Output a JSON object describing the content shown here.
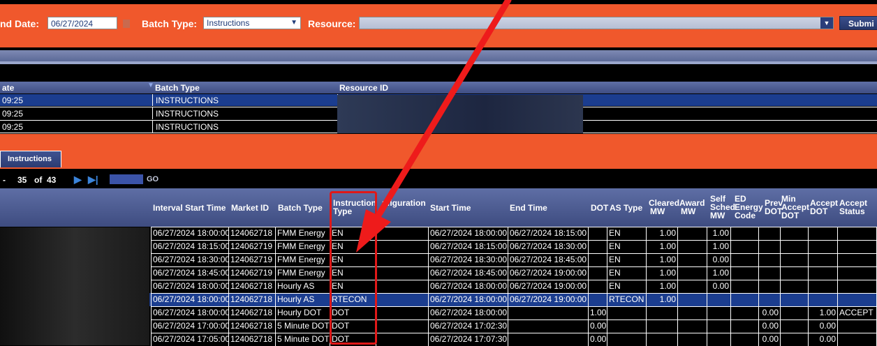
{
  "toolbar": {
    "end_date_label": "nd Date:",
    "end_date_value": "06/27/2024",
    "batch_type_label": "Batch Type:",
    "batch_type_value": "Instructions",
    "resource_label": "Resource:",
    "submit_label": "Submi"
  },
  "batch_table": {
    "headers": [
      "ate",
      "Batch Type",
      "Resource ID"
    ],
    "rows": [
      {
        "time": "09:25",
        "batch_type": "INSTRUCTIONS"
      },
      {
        "time": "09:25",
        "batch_type": "INSTRUCTIONS"
      },
      {
        "time": "09:25",
        "batch_type": "INSTRUCTIONS"
      }
    ]
  },
  "tab": {
    "label": "Instructions"
  },
  "pager": {
    "dash": "-",
    "current": "35",
    "of": "of",
    "total": "43",
    "go": "GO"
  },
  "grid": {
    "headers": {
      "interval_start": "Interval Start Time",
      "market_id": "Market ID",
      "batch_type": "Batch Type",
      "instr1": "Instruction",
      "instr2": "Type",
      "config": "nfiguration",
      "start_time": "Start Time",
      "end_time": "End Time",
      "dot": "DOT",
      "as_type": "AS Type",
      "cleared1": "Cleared",
      "cleared2": "MW",
      "award1": "Award",
      "award2": "MW",
      "self1": "Self",
      "self2": "Sched",
      "self3": "MW",
      "ed1": "ED",
      "ed2": "Energy",
      "ed3": "Code",
      "prev1": "Prev",
      "prev2": "DOT",
      "min1": "Min",
      "min2": "Accept",
      "min3": "DOT",
      "accept1": "Accept",
      "accept2": "DOT",
      "astatus1": "Accept",
      "astatus2": "Status"
    },
    "rows": [
      {
        "interval": "06/27/2024 18:00:00",
        "market": "124062718",
        "batch": "FMM Energy",
        "itype": "EN",
        "start": "06/27/2024 18:00:00",
        "end": "06/27/2024 18:15:00",
        "dot": "",
        "as": "EN",
        "cleared": "1.00",
        "award": "",
        "self": "1.00",
        "prev": "",
        "accept": "",
        "status": ""
      },
      {
        "interval": "06/27/2024 18:15:00",
        "market": "124062719",
        "batch": "FMM Energy",
        "itype": "EN",
        "start": "06/27/2024 18:15:00",
        "end": "06/27/2024 18:30:00",
        "dot": "",
        "as": "EN",
        "cleared": "1.00",
        "award": "",
        "self": "1.00",
        "prev": "",
        "accept": "",
        "status": ""
      },
      {
        "interval": "06/27/2024 18:30:00",
        "market": "124062719",
        "batch": "FMM Energy",
        "itype": "EN",
        "start": "06/27/2024 18:30:00",
        "end": "06/27/2024 18:45:00",
        "dot": "",
        "as": "EN",
        "cleared": "1.00",
        "award": "",
        "self": "0.00",
        "prev": "",
        "accept": "",
        "status": ""
      },
      {
        "interval": "06/27/2024 18:45:00",
        "market": "124062719",
        "batch": "FMM Energy",
        "itype": "EN",
        "start": "06/27/2024 18:45:00",
        "end": "06/27/2024 19:00:00",
        "dot": "",
        "as": "EN",
        "cleared": "1.00",
        "award": "",
        "self": "1.00",
        "prev": "",
        "accept": "",
        "status": ""
      },
      {
        "interval": "06/27/2024 18:00:00",
        "market": "124062718",
        "batch": "Hourly AS",
        "itype": "EN",
        "start": "06/27/2024 18:00:00",
        "end": "06/27/2024 19:00:00",
        "dot": "",
        "as": "EN",
        "cleared": "1.00",
        "award": "",
        "self": "0.00",
        "prev": "",
        "accept": "",
        "status": ""
      },
      {
        "interval": "06/27/2024 18:00:00",
        "market": "124062718",
        "batch": "Hourly AS",
        "itype": "RTECON",
        "start": "06/27/2024 18:00:00",
        "end": "06/27/2024 19:00:00",
        "dot": "",
        "as": "RTECON",
        "cleared": "1.00",
        "award": "",
        "self": "",
        "prev": "",
        "accept": "",
        "status": ""
      },
      {
        "interval": "06/27/2024 18:00:00",
        "market": "124062718",
        "batch": "Hourly DOT",
        "itype": "DOT",
        "start": "06/27/2024 18:00:00",
        "end": "",
        "dot": "1.00",
        "as": "",
        "cleared": "",
        "award": "",
        "self": "",
        "prev": "0.00",
        "accept": "1.00",
        "status": "ACCEPT"
      },
      {
        "interval": "06/27/2024 17:00:00",
        "market": "124062718",
        "batch": "5 Minute DOT",
        "itype": "DOT",
        "start": "06/27/2024 17:02:30",
        "end": "",
        "dot": "0.00",
        "as": "",
        "cleared": "",
        "award": "",
        "self": "",
        "prev": "0.00",
        "accept": "0.00",
        "status": ""
      },
      {
        "interval": "06/27/2024 17:05:00",
        "market": "124062718",
        "batch": "5 Minute DOT",
        "itype": "DOT",
        "start": "06/27/2024 17:07:30",
        "end": "",
        "dot": "0.00",
        "as": "",
        "cleared": "",
        "award": "",
        "self": "",
        "prev": "0.00",
        "accept": "0.00",
        "status": ""
      }
    ]
  },
  "colors": {
    "orange": "#f0582c",
    "header_blue": "#4a5a92",
    "selected_row": "#1b3d8f",
    "annotation_red": "#e01818"
  }
}
